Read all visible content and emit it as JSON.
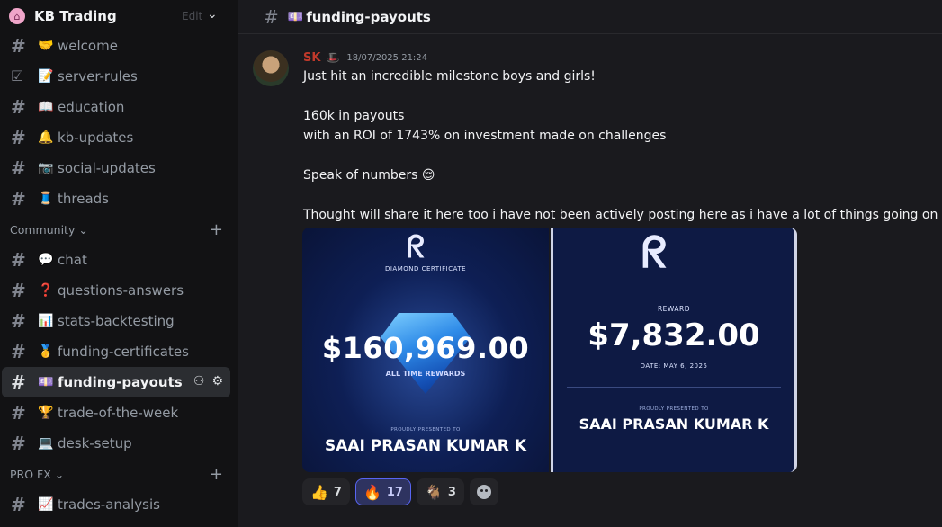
{
  "server": {
    "name": "KB Trading",
    "ghost_text": "Edit",
    "icon": "house-icon"
  },
  "channels_top": [
    {
      "emoji": "🤝",
      "label": "welcome",
      "icon": "hash-icon"
    },
    {
      "emoji": "📝",
      "label": "server-rules",
      "icon": "checklist-icon"
    },
    {
      "emoji": "📖",
      "label": "education",
      "icon": "hash-icon"
    },
    {
      "emoji": "🔔",
      "label": "kb-updates",
      "icon": "hash-icon"
    },
    {
      "emoji": "📷",
      "label": "social-updates",
      "icon": "hash-icon"
    },
    {
      "emoji": "🧵",
      "label": "threads",
      "icon": "hash-icon"
    }
  ],
  "category_community": "Community",
  "channels_community": [
    {
      "emoji": "💬",
      "label": "chat"
    },
    {
      "emoji": "❓",
      "label": "questions-answers"
    },
    {
      "emoji": "📊",
      "label": "stats-backtesting"
    },
    {
      "emoji": "🥇",
      "label": "funding-certificates"
    },
    {
      "emoji": "💷",
      "label": "funding-payouts",
      "active": true
    },
    {
      "emoji": "🏆",
      "label": "trade-of-the-week"
    },
    {
      "emoji": "💻",
      "label": "desk-setup"
    }
  ],
  "category_profx": "PRO FX",
  "channels_profx": [
    {
      "emoji": "📈",
      "label": "trades-analysis"
    }
  ],
  "topbar": {
    "emoji": "💷",
    "title": "funding-payouts"
  },
  "message": {
    "author": "SK",
    "badge": "🎩",
    "timestamp": "18/07/2025 21:24",
    "lines": [
      "Just hit an incredible milestone boys and girls!",
      "",
      "160k in payouts",
      "with an ROI of 1743% on investment made on challenges",
      "",
      "Speak of numbers 😌",
      "",
      "Thought will share it here too i have not been actively posting here as i have a lot of things going on rn"
    ]
  },
  "attachment_left": {
    "cert_title": "DIAMOND CERTIFICATE",
    "amount": "$160,969.00",
    "sub": "ALL TIME REWARDS",
    "presented": "PROUDLY PRESENTED TO",
    "recipient": "SAAI PRASAN KUMAR K"
  },
  "attachment_right": {
    "label": "REWARD",
    "amount": "$7,832.00",
    "date_label": "DATE:",
    "date": "MAY 6, 2025",
    "presented": "PROUDLY PRESENTED TO",
    "recipient": "SAAI PRASAN KUMAR K"
  },
  "reactions": [
    {
      "emoji": "👍",
      "count": "7",
      "active": false
    },
    {
      "emoji": "🔥",
      "count": "17",
      "active": true
    },
    {
      "emoji": "🐐",
      "count": "3",
      "active": false
    }
  ],
  "colors": {
    "author": "#c0392b",
    "accent": "#5865f2",
    "sidebar_bg": "#121214",
    "main_bg": "#1a1a1e"
  }
}
